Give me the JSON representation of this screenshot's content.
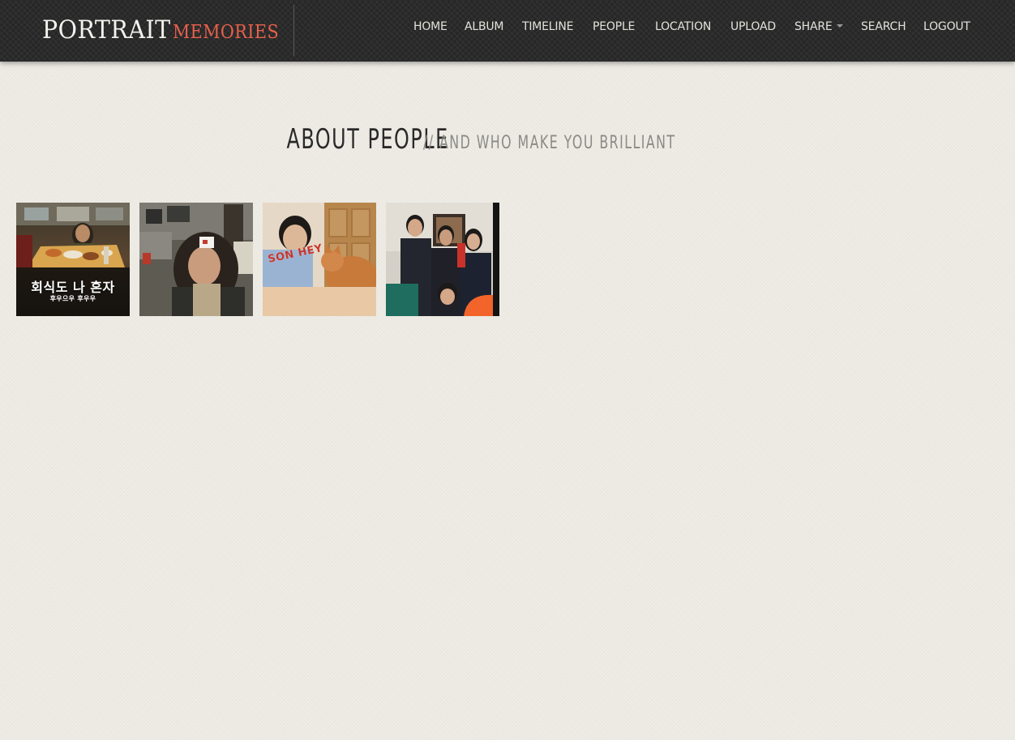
{
  "brand": {
    "main": "PORTRAIT",
    "accent": "MEMORIES"
  },
  "nav": {
    "items": [
      {
        "label": "HOME"
      },
      {
        "label": "ALBUM"
      },
      {
        "label": "TIMELINE"
      },
      {
        "label": "PEOPLE"
      },
      {
        "label": "LOCATION"
      },
      {
        "label": "UPLOAD"
      },
      {
        "label": "SHARE"
      },
      {
        "label": "SEARCH"
      },
      {
        "label": "LOGOUT"
      }
    ]
  },
  "heading": {
    "title": "ABOUT PEOPLE",
    "subtitle": "// AND WHO MAKE YOU BRILLIANT"
  },
  "gallery": {
    "photos": [
      {
        "caption": "회식도 나 혼자",
        "subcaption": "후우으우 후우우"
      },
      {
        "caption": ""
      },
      {
        "caption": "",
        "sign": "SON HEY"
      },
      {
        "caption": ""
      }
    ]
  },
  "colors": {
    "brand_accent": "#e8604c",
    "navbar_bg": "#2b2b2b",
    "page_bg": "#efede6"
  }
}
